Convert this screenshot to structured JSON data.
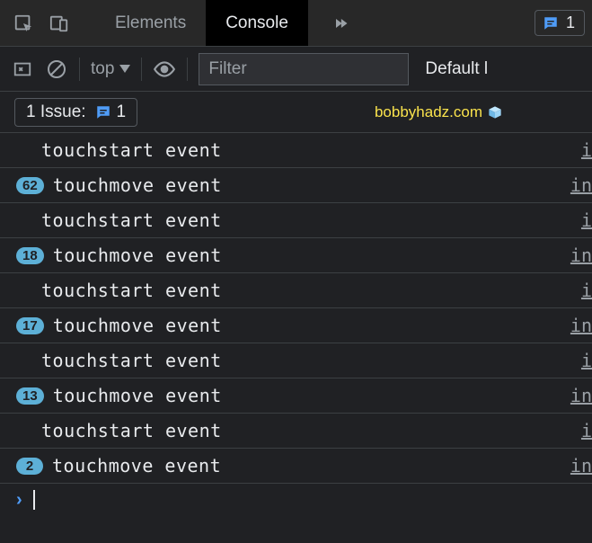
{
  "tabs": {
    "elements": "Elements",
    "console": "Console"
  },
  "header": {
    "issue_count": "1"
  },
  "toolbar": {
    "context": "top",
    "filter_placeholder": "Filter",
    "levels": "Default l"
  },
  "issues": {
    "label": "1 Issue:",
    "count": "1"
  },
  "brand": "bobbyhadz.com",
  "src_short": "i",
  "src_long": "in",
  "logs": [
    {
      "badge": "",
      "msg": "touchstart event",
      "src": "i"
    },
    {
      "badge": "62",
      "msg": "touchmove event",
      "src": "in"
    },
    {
      "badge": "",
      "msg": "touchstart event",
      "src": "i"
    },
    {
      "badge": "18",
      "msg": "touchmove event",
      "src": "in"
    },
    {
      "badge": "",
      "msg": "touchstart event",
      "src": "i"
    },
    {
      "badge": "17",
      "msg": "touchmove event",
      "src": "in"
    },
    {
      "badge": "",
      "msg": "touchstart event",
      "src": "i"
    },
    {
      "badge": "13",
      "msg": "touchmove event",
      "src": "in"
    },
    {
      "badge": "",
      "msg": "touchstart event",
      "src": "i"
    },
    {
      "badge": "2",
      "msg": "touchmove event",
      "src": "in"
    }
  ]
}
